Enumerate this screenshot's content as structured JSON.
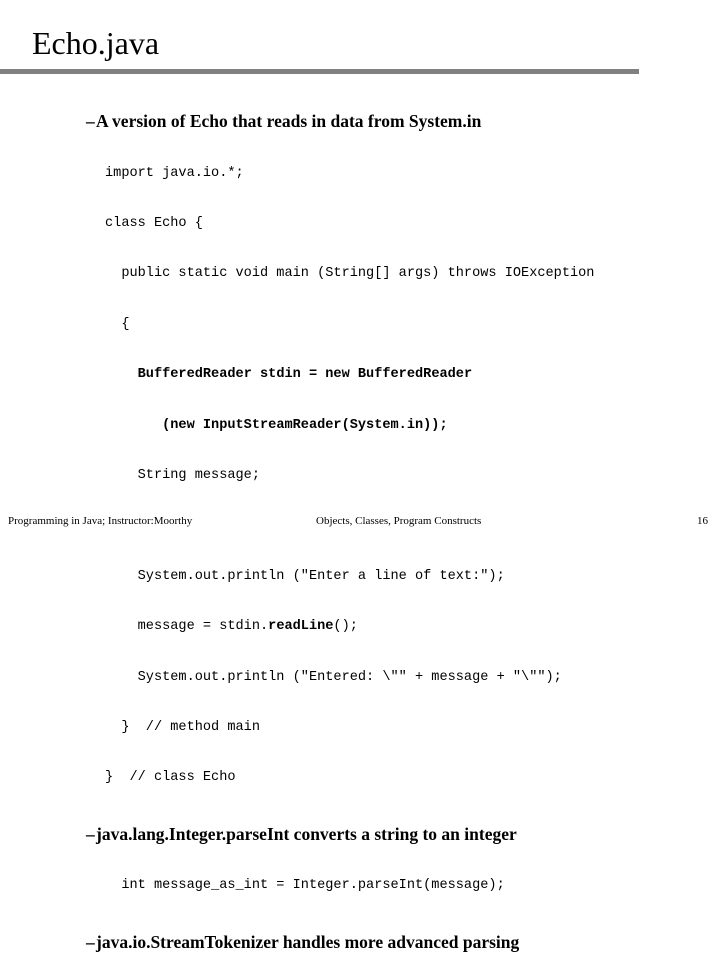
{
  "slide": {
    "title": "Echo.java",
    "page_number": "16",
    "rule_color": "#808080"
  },
  "bullets": [
    {
      "dash": "–",
      "text": "A version of Echo that reads in data from System.in"
    },
    {
      "dash": "–",
      "text": "java.lang.Integer.parseInt converts a string to an integer"
    },
    {
      "dash": "–",
      "text": "java.io.StreamTokenizer handles more advanced parsing"
    }
  ],
  "code_main": {
    "lines": [
      {
        "pre": "import java.io.*;",
        "bold": "",
        "post": ""
      },
      {
        "pre": "class Echo {",
        "bold": "",
        "post": ""
      },
      {
        "pre": "  public static void main (String[] args) throws IOException",
        "bold": "",
        "post": ""
      },
      {
        "pre": "  {",
        "bold": "",
        "post": ""
      },
      {
        "pre": "    ",
        "bold": "BufferedReader stdin = new BufferedReader",
        "post": ""
      },
      {
        "pre": "       ",
        "bold": "(new InputStreamReader(System.in));",
        "post": ""
      },
      {
        "pre": "    String message;",
        "bold": "",
        "post": ""
      },
      {
        "pre": "",
        "bold": "",
        "post": ""
      },
      {
        "pre": "    System.out.println (\"Enter a line of text:\");",
        "bold": "",
        "post": ""
      },
      {
        "pre": "    message = stdin.",
        "bold": "readLine",
        "post": "();"
      },
      {
        "pre": "    System.out.println (\"Entered: \\\"\" + message + \"\\\"\");",
        "bold": "",
        "post": ""
      },
      {
        "pre": "  }  // method main",
        "bold": "",
        "post": ""
      },
      {
        "pre": "}  // class Echo",
        "bold": "",
        "post": ""
      }
    ]
  },
  "code_parseint": {
    "lines": [
      {
        "pre": "  int message_as_int = Integer.parseInt(message);",
        "bold": "",
        "post": ""
      }
    ]
  },
  "footer": {
    "left": "Programming in Java; Instructor:Moorthy",
    "center": "Objects, Classes, Program Constructs",
    "page": "16"
  }
}
